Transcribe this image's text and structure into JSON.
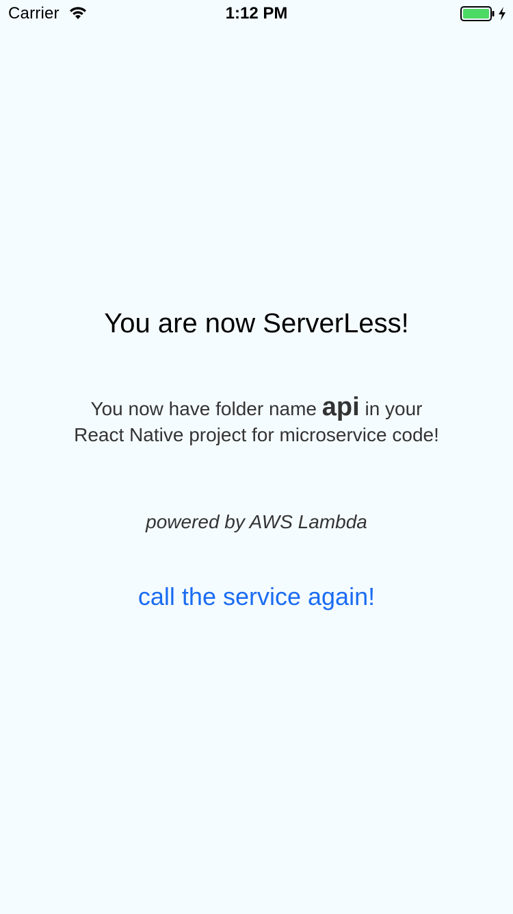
{
  "status_bar": {
    "carrier": "Carrier",
    "time": "1:12 PM",
    "icons": {
      "wifi": "wifi-icon",
      "battery": "battery-icon",
      "charging": "charging-bolt-icon"
    },
    "battery_color": "#4CD964"
  },
  "main": {
    "welcome": "You are now ServerLess!",
    "instructions": {
      "prefix": "You now have folder name ",
      "folder_name": "api",
      "suffix": " in your",
      "line2": "React Native project for microservice code!"
    },
    "powered_by": "powered by AWS Lambda",
    "call_again_label": "call the service again!"
  },
  "colors": {
    "background": "#F5FCFF",
    "link": "#1B6CF2",
    "text": "#333333"
  }
}
